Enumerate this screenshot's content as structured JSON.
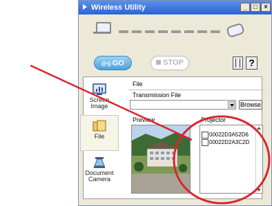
{
  "window": {
    "title": "Wireless Utility",
    "controls": {
      "minimize": "_",
      "maximize": "□",
      "close": "×"
    }
  },
  "toolbar": {
    "go_label": "GO",
    "go_icon": "wifi-signal-icon",
    "stop_label": "STOP",
    "stop_icon": "stop-square-icon",
    "help_label": "?"
  },
  "modes": [
    {
      "label": "Screen Image",
      "icon": "screen-chart-icon",
      "selected": false
    },
    {
      "label": "File",
      "icon": "folder-icon",
      "selected": true
    },
    {
      "label": "Document Camera",
      "icon": "document-camera-icon",
      "selected": false
    }
  ],
  "file_section": {
    "title": "File",
    "transmission_label": "Transmission File",
    "transmission_value": "",
    "browse_label": "Browse",
    "preview_label": "Preview",
    "projector_label": "Projector",
    "projectors": [
      "00022D3A52D6",
      "00022D2A3C2D"
    ]
  },
  "colors": {
    "accent": "#d9252c",
    "titlebar": "#2a63d6",
    "go_button": "#4aa0dc"
  }
}
